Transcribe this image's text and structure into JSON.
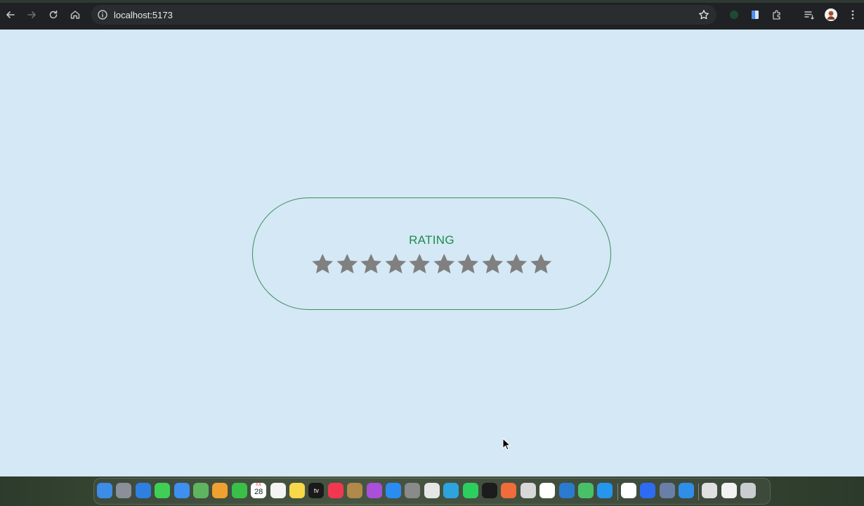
{
  "browser": {
    "url": "localhost:5173"
  },
  "page": {
    "title": "RATING",
    "star_count": 10,
    "rating_value": 0,
    "star_color": "#808080",
    "accent_color": "#1f8a4c",
    "background": "#d4e8f5"
  },
  "dock": {
    "apps": [
      "finder-icon",
      "launchpad-icon",
      "safari-icon",
      "messages-icon",
      "mail-icon",
      "maps-icon",
      "photos-icon",
      "facetime-icon",
      "calendar-icon",
      "reminders-icon",
      "notes-icon",
      "tv-icon",
      "music-icon",
      "stickies-icon",
      "podcasts-icon",
      "app-store-icon",
      "system-settings-icon",
      "chrome-icon",
      "telegram-icon",
      "whatsapp-icon",
      "terminal-icon",
      "postman-icon",
      "roblox-icon",
      "threads-icon",
      "vscode-icon",
      "thunder-icon",
      "docker-icon",
      "tasks-icon",
      "zoom-icon",
      "screen-icon",
      "keynote-icon",
      "archive-icon",
      "files-icon",
      "trash-icon"
    ],
    "calendar_day": "28",
    "calendar_month": "JUL",
    "tv_label": "tv"
  }
}
